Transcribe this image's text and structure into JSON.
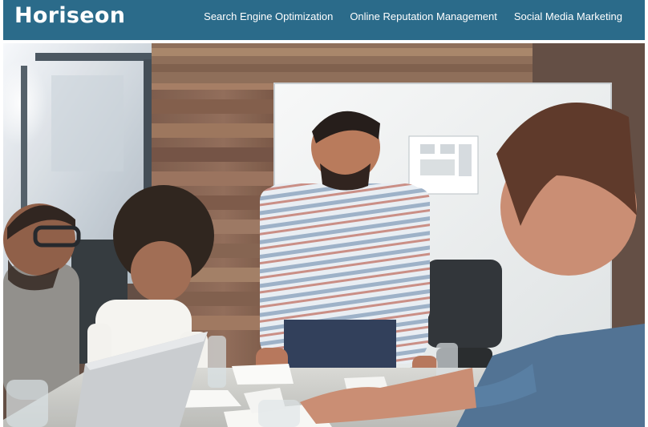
{
  "header": {
    "logo": "Horiseon",
    "background_color": "#2b6b8a",
    "nav": [
      {
        "label": "Search Engine Optimization"
      },
      {
        "label": "Online Reputation Management"
      },
      {
        "label": "Social Media Marketing"
      }
    ]
  },
  "hero": {
    "image_alt": "team meeting"
  }
}
